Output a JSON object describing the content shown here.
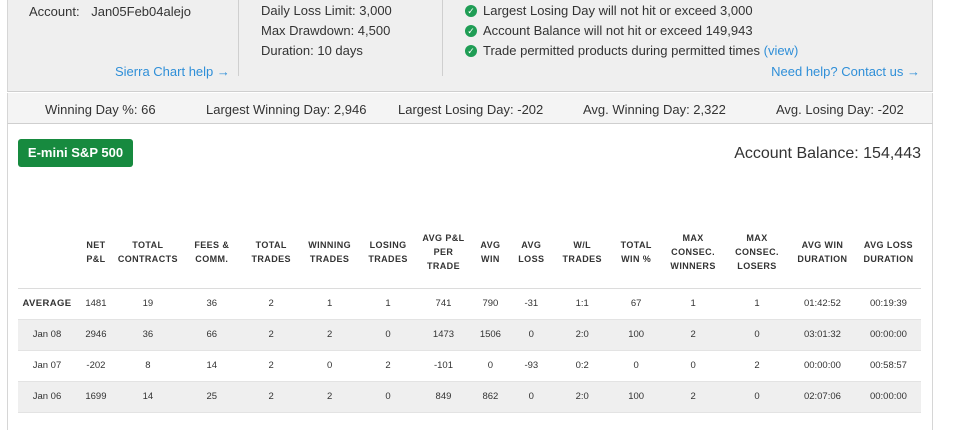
{
  "account": {
    "label": "Account:",
    "value": "Jan05Feb04alejo",
    "help_link": "Sierra Chart help →"
  },
  "limits": [
    "Daily Loss Limit: 3,000",
    "Max Drawdown: 4,500",
    "Duration: 10 days"
  ],
  "rules": {
    "items": [
      "Largest Losing Day will not hit or exceed 3,000",
      "Account Balance will not hit or exceed 149,943",
      "Trade permitted products during permitted times"
    ],
    "view_link": "(view)",
    "contact_link": "Need help? Contact us →"
  },
  "stats_bar": {
    "winning_day_pct": "Winning Day %: 66",
    "largest_winning_day": "Largest Winning Day: 2,946",
    "largest_losing_day": "Largest Losing Day: -202",
    "avg_winning_day": "Avg. Winning Day: 2,322",
    "avg_losing_day": "Avg. Losing Day: -202"
  },
  "product_button": "E-mini S&P 500",
  "account_balance": "Account Balance: 154,443",
  "table": {
    "headers": [
      "",
      "NET P&L",
      "TOTAL CONTRACTS",
      "FEES & COMM.",
      "TOTAL TRADES",
      "WINNING TRADES",
      "LOSING TRADES",
      "AVG P&L PER TRADE",
      "AVG WIN",
      "AVG LOSS",
      "W/L TRADES",
      "TOTAL WIN %",
      "MAX CONSEC. WINNERS",
      "MAX CONSEC. LOSERS",
      "AVG WIN DURATION",
      "AVG LOSS DURATION"
    ],
    "rows": [
      [
        "AVERAGE",
        "1481",
        "19",
        "36",
        "2",
        "1",
        "1",
        "741",
        "790",
        "-31",
        "1:1",
        "67",
        "1",
        "1",
        "01:42:52",
        "00:19:39"
      ],
      [
        "Jan 08",
        "2946",
        "36",
        "66",
        "2",
        "2",
        "0",
        "1473",
        "1506",
        "0",
        "2:0",
        "100",
        "2",
        "0",
        "03:01:32",
        "00:00:00"
      ],
      [
        "Jan 07",
        "-202",
        "8",
        "14",
        "2",
        "0",
        "2",
        "-101",
        "0",
        "-93",
        "0:2",
        "0",
        "0",
        "2",
        "00:00:00",
        "00:58:57"
      ],
      [
        "Jan 06",
        "1699",
        "14",
        "25",
        "2",
        "2",
        "0",
        "849",
        "862",
        "0",
        "2:0",
        "100",
        "2",
        "0",
        "02:07:06",
        "00:00:00"
      ]
    ]
  }
}
